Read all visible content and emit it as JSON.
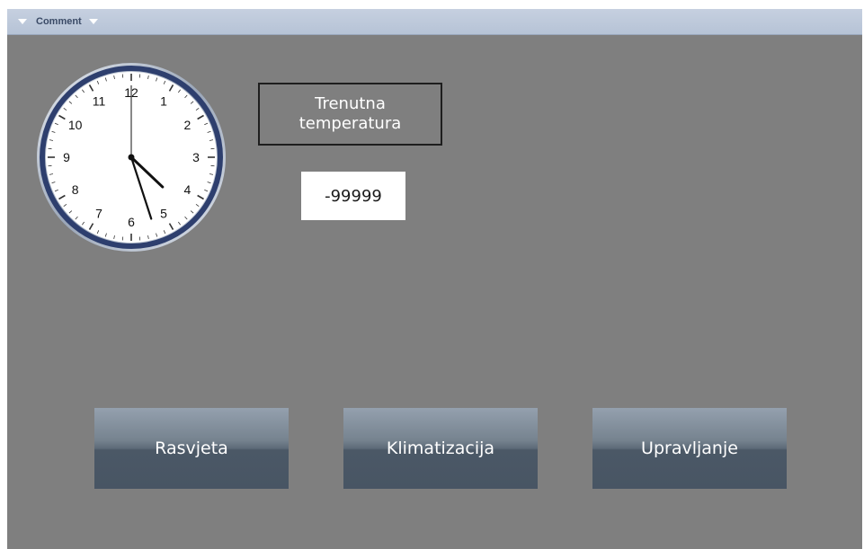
{
  "comment_bar": {
    "label": "Comment",
    "left_icon": "triangle-down-icon",
    "right_icon": "triangle-down-icon"
  },
  "clock": {
    "numbers": [
      "12",
      "1",
      "2",
      "3",
      "4",
      "5",
      "6",
      "7",
      "8",
      "9",
      "10",
      "11"
    ],
    "time": "16:27:00",
    "face_color": "#ffffff",
    "rim_color": "#2e3f6e"
  },
  "temperature": {
    "label": "Trenutna temperatura",
    "value": "-99999"
  },
  "buttons": [
    {
      "label": "Rasvjeta"
    },
    {
      "label": "Klimatizacija"
    },
    {
      "label": "Upravljanje"
    }
  ],
  "colors": {
    "background": "#7f7f7f",
    "button_top": "#94a0ae",
    "button_bottom": "#485564"
  }
}
